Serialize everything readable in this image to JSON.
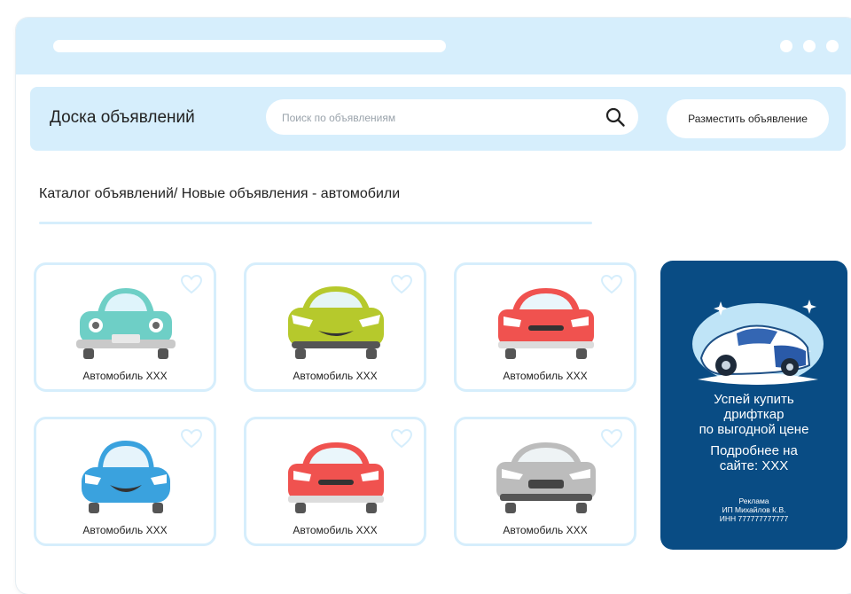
{
  "header": {
    "site_title": "Доска объявлений",
    "search_placeholder": "Поиск по объявлениям",
    "post_button": "Разместить объявление"
  },
  "breadcrumb": "Каталог объявлений/ Новые объявления - автомобили",
  "listings": [
    {
      "title": "Автомобиль XXX",
      "color": "#6ecfc6"
    },
    {
      "title": "Автомобиль XXX",
      "color": "#b6c92c"
    },
    {
      "title": "Автомобиль XXX",
      "color": "#f0524f"
    },
    {
      "title": "Автомобиль XXX",
      "color": "#3aa2de"
    },
    {
      "title": "Автомобиль XXX",
      "color": "#f0524f"
    },
    {
      "title": "Автомобиль XXX",
      "color": "#bcbcbc"
    }
  ],
  "ad": {
    "line1": "Успей купить",
    "line2": "дрифткар",
    "line3": "по выгодной цене",
    "line4": "Подробнее на",
    "line5": "сайте: XXX",
    "small1": "Реклама",
    "small2": "ИП Михайлов К.В.",
    "small3": "ИНН 777777777777"
  },
  "colors": {
    "accent_light": "#d6eefc",
    "ad_background": "#094c84"
  },
  "icons": [
    "search-icon",
    "heart-icon",
    "car-icon"
  ]
}
